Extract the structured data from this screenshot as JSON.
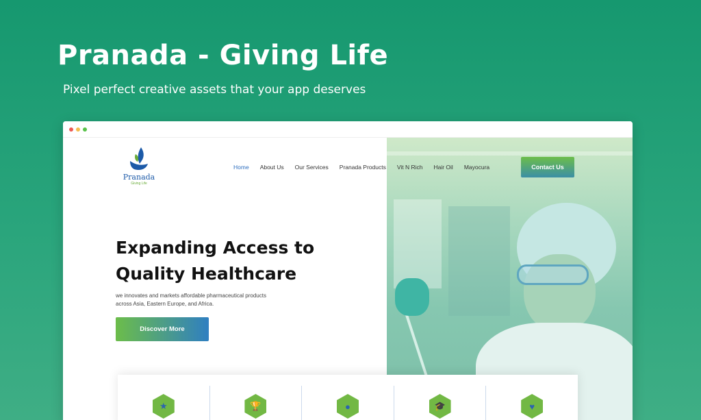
{
  "hero": {
    "title": "Pranada - Giving Life",
    "subtitle": "Pixel perfect creative assets that your app deserves"
  },
  "browser": {
    "dots": [
      "red",
      "yellow",
      "green"
    ]
  },
  "site": {
    "logo": {
      "brand": "Pranada",
      "tagline": "Giving Life"
    },
    "nav": [
      {
        "label": "Home",
        "active": true
      },
      {
        "label": "About Us",
        "active": false
      },
      {
        "label": "Our Services",
        "active": false
      },
      {
        "label": "Pranada Products",
        "active": false
      },
      {
        "label": "Vit N Rich",
        "active": false
      },
      {
        "label": "Hair Oil",
        "active": false
      },
      {
        "label": "Mayocura",
        "active": false
      }
    ],
    "contact_label": "Contact Us",
    "headline_line1": "Expanding Access to",
    "headline_line2": "Quality Healthcare",
    "subtext_line1": "we innovates and markets affordable pharmaceutical products",
    "subtext_line2": "across Asia, Eastern Europe, and Africa.",
    "discover_label": "Discover More",
    "features": [
      {
        "icon": "star-icon",
        "glyph": "★"
      },
      {
        "icon": "trophy-icon",
        "glyph": "🏆"
      },
      {
        "icon": "user-icon",
        "glyph": "●"
      },
      {
        "icon": "graduation-cap-icon",
        "glyph": "🎓"
      },
      {
        "icon": "heart-icon",
        "glyph": "♥"
      }
    ]
  },
  "colors": {
    "background_top": "#16986f",
    "accent_green": "#6cbd4a",
    "accent_blue": "#2f7fc1",
    "nav_active": "#2f6fbf"
  }
}
